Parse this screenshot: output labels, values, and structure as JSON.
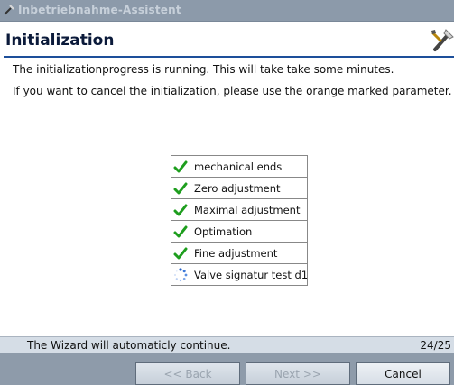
{
  "window": {
    "title": "Inbetriebnahme-Assistent"
  },
  "header": {
    "title": "Initialization"
  },
  "messages": {
    "line1": "The initializationprogress is running. This will take take some minutes.",
    "line2": "If you want to cancel the initialization, please use the orange marked parameter."
  },
  "steps": [
    {
      "label": "mechanical ends",
      "status": "done",
      "icon": "check-icon"
    },
    {
      "label": "Zero adjustment",
      "status": "done",
      "icon": "check-icon"
    },
    {
      "label": "Maximal adjustment",
      "status": "done",
      "icon": "check-icon"
    },
    {
      "label": "Optimation",
      "status": "done",
      "icon": "check-icon"
    },
    {
      "label": "Fine adjustment",
      "status": "done",
      "icon": "check-icon"
    },
    {
      "label": "Valve signatur test d1",
      "status": "in-progress",
      "icon": "spinner-icon"
    }
  ],
  "status": {
    "text": "The Wizard will automaticly continue.",
    "page": "24/25"
  },
  "buttons": {
    "back": "<< Back",
    "next": "Next >>",
    "cancel": "Cancel"
  },
  "colors": {
    "accent": "#1d4f9a",
    "check": "#1e9e1e",
    "titlebar": "#8c9aaa"
  }
}
